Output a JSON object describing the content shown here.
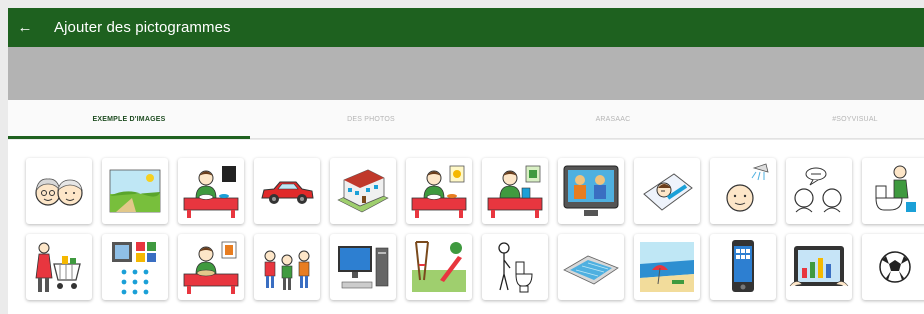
{
  "header": {
    "title": "Ajouter des pictogrammes",
    "back_icon": "arrow-left-icon",
    "background": "#1e611f"
  },
  "tabs": [
    {
      "label": "EXEMPLE D'IMAGES",
      "active": true
    },
    {
      "label": "DES PHOTOS",
      "active": false
    },
    {
      "label": "ARASAAC",
      "active": false
    },
    {
      "label": "#SOYVISUAL",
      "active": false
    }
  ],
  "accent_color": "#1e611f",
  "pictograms": [
    "elderly-couple-icon",
    "landscape-icon",
    "dinner-night-icon",
    "car-icon",
    "school-building-icon",
    "lunch-day-icon",
    "cooking-icon",
    "television-family-icon",
    "sleeping-child-icon",
    "shower-baby-icon",
    "conversation-icon",
    "toilet-person-icon",
    "shopping-cart-icon",
    "puzzle-game-icon",
    "baking-icon",
    "friends-group-icon",
    "desktop-computer-icon",
    "playground-icon",
    "toilet-stand-icon",
    "swimming-pool-icon",
    "beach-icon",
    "smartphone-icon",
    "tablet-icon",
    "soccer-ball-icon"
  ]
}
